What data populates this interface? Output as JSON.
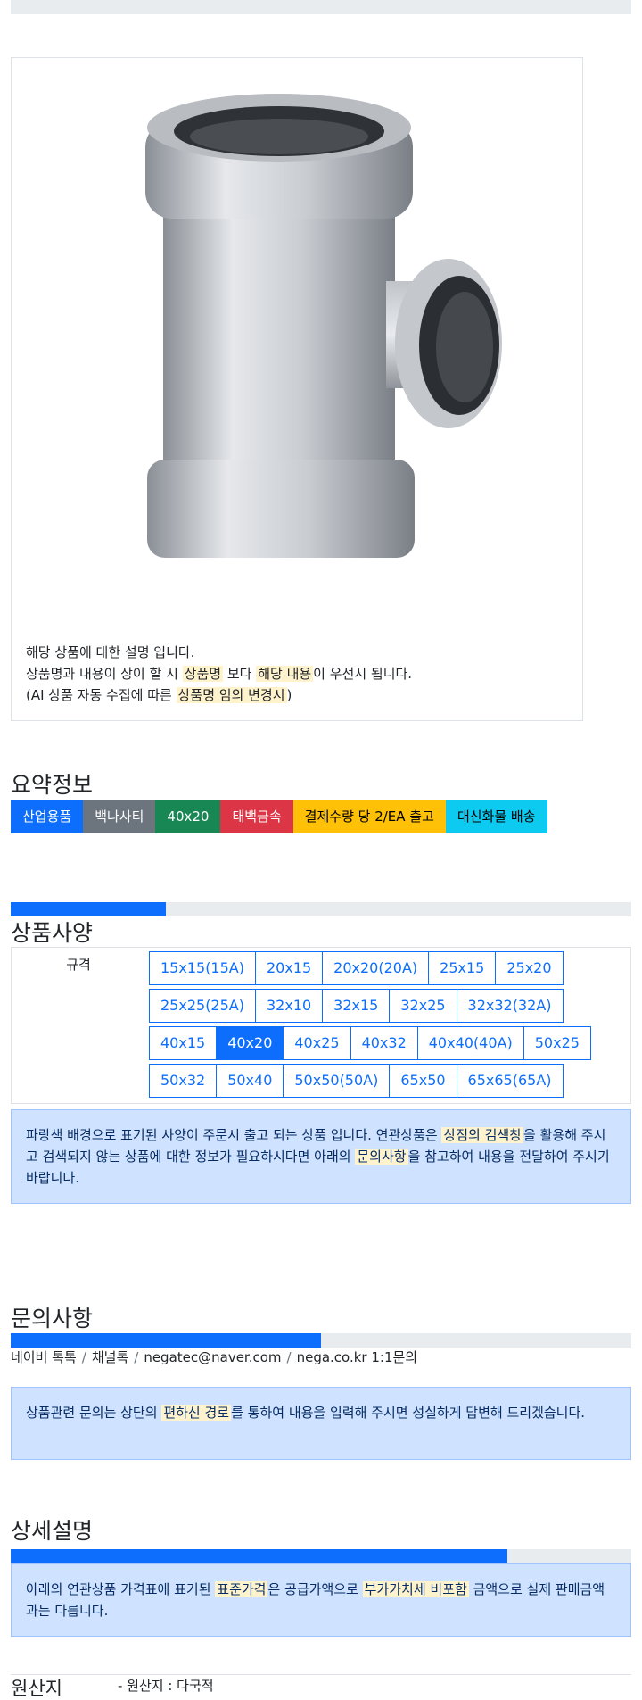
{
  "product": {
    "desc_line1": "해당 상품에 대한 설명 입니다.",
    "desc_line2_a": "상품명과 내용이 상이 할 시 ",
    "desc_line2_hl1": "상품명",
    "desc_line2_b": " 보다 ",
    "desc_line2_hl2": "해당 내용",
    "desc_line2_c": "이 우선시 됩니다.",
    "desc_line3_a": "(AI 상품 자동 수집에 따른 ",
    "desc_line3_hl": "상품명 임의 변경시",
    "desc_line3_b": ")"
  },
  "summary": {
    "title": "요약정보",
    "tags": [
      {
        "label": "산업용품",
        "color": "#0d6efd"
      },
      {
        "label": "백나사티",
        "color": "#6c757d"
      },
      {
        "label": "40x20",
        "color": "#198754"
      },
      {
        "label": "태백금속",
        "color": "#dc3545"
      },
      {
        "label": "결제수량 당 2/EA 출고",
        "color": "#ffc107"
      },
      {
        "label": "대신화물 배송",
        "color": "#0dcaf0"
      }
    ]
  },
  "spec": {
    "title": "상품사양",
    "label": "규격",
    "rows": [
      [
        "15x15(15A)",
        "20x15",
        "20x20(20A)",
        "25x15",
        "25x20"
      ],
      [
        "25x25(25A)",
        "32x10",
        "32x15",
        "32x25",
        "32x32(32A)"
      ],
      [
        "40x15",
        "40x20",
        "40x25",
        "40x32",
        "40x40(40A)",
        "50x25"
      ],
      [
        "50x32",
        "50x40",
        "50x50(50A)",
        "65x50",
        "65x65(65A)"
      ]
    ],
    "selected": "40x20",
    "progress": 0.25,
    "notice_a": "파랑색 배경으로 표기된 사양이 주문시 출고 되는 상품 입니다. 연관상품은 ",
    "notice_hl1": "상점의 검색창",
    "notice_b": "을 활용해 주시고 검색되지 않는 상품에 대한 정보가 필요하시다면 아래의 ",
    "notice_hl2": "문의사항",
    "notice_c": "을 참고하여 내용을 전달하여 주시기 바랍니다."
  },
  "inquiry": {
    "title": "문의사항",
    "progress": 0.5,
    "links": [
      "네이버 톡톡",
      "채널톡",
      "negatec@naver.com",
      "nega.co.kr 1:1문의"
    ],
    "notice_a": "상품관련 문의는 상단의 ",
    "notice_hl": "편하신 경로",
    "notice_b": "를 통하여 내용을 입력해 주시면 성실하게 답변해 드리겠습니다."
  },
  "detail": {
    "title": "상세설명",
    "progress": 0.8,
    "notice_a": "아래의 연관상품 가격표에 표기된 ",
    "notice_hl1": "표준가격",
    "notice_b": "은 공급가액으로 ",
    "notice_hl2": "부가가치세 비포함",
    "notice_c": " 금액으로 실제 판매금액과는 다릅니다."
  },
  "origin": {
    "label": "원산지",
    "value": "- 원산지 : 다국적"
  },
  "colors": {
    "primary": "#0d6efd",
    "track": "#e9ecef",
    "highlight": "#fff3cd",
    "alert_bg": "#cfe2ff"
  }
}
